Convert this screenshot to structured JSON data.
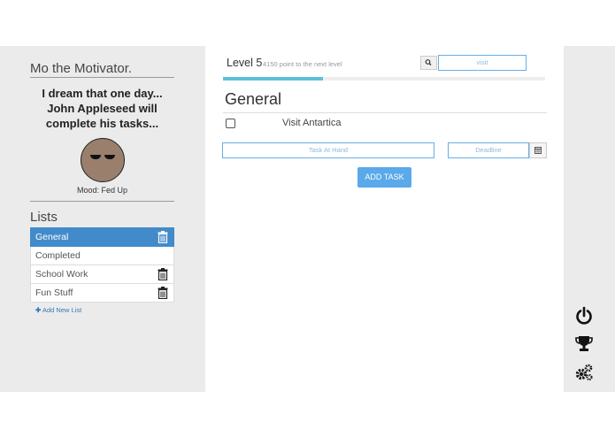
{
  "sidebar": {
    "title": "Mo the Motivator.",
    "quote": "I dream that one day... John Appleseed will complete his tasks...",
    "mood": "Mood: Fed Up",
    "lists_title": "Lists",
    "items": [
      {
        "label": "General",
        "active": true,
        "deletable": true
      },
      {
        "label": "Completed",
        "active": false,
        "deletable": false
      },
      {
        "label": "School Work",
        "active": false,
        "deletable": true
      },
      {
        "label": "Fun Stuff",
        "active": false,
        "deletable": true
      }
    ],
    "add_list": "Add New List"
  },
  "header": {
    "level": "Level 5",
    "points_text": "4150 point to the next level",
    "progress_fraction": 0.31,
    "search_value": "visit"
  },
  "main": {
    "list_heading": "General",
    "tasks": [
      {
        "text": "Visit Antartica",
        "done": false
      }
    ],
    "task_placeholder": "Task At Hand",
    "deadline_placeholder": "Deadline",
    "add_task_label": "ADD TASK"
  },
  "rail": {
    "icons": [
      "power-icon",
      "trophy-icon",
      "gears-icon"
    ]
  },
  "colors": {
    "accent": "#428bca",
    "progress": "#5bc0de",
    "panel_bg": "#ebebeb"
  }
}
